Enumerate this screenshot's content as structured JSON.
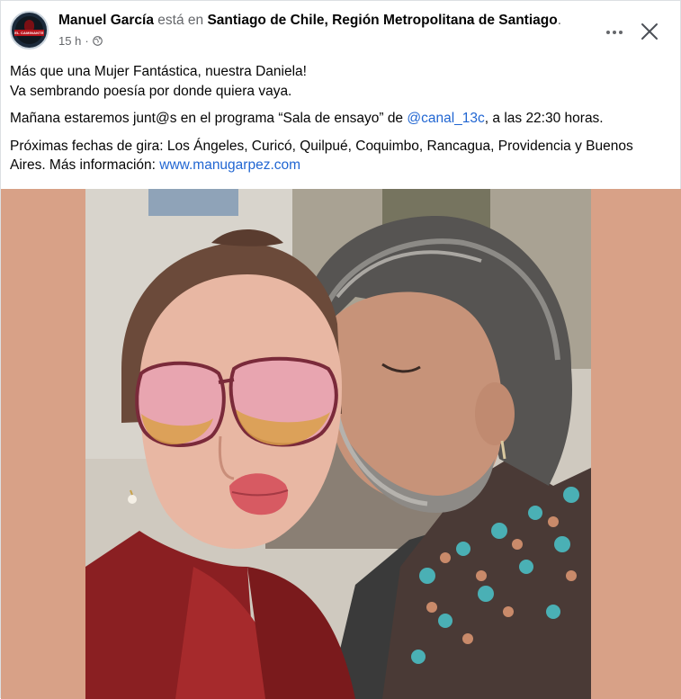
{
  "post": {
    "author": "Manuel García",
    "verb": "está en",
    "location": "Santiago de Chile, Región Metropolitana de Santiago",
    "time": "15 h",
    "separator": "·",
    "avatar_text": "EL CAMINANTE",
    "paragraphs": {
      "p1_line1": "Más que una Mujer Fantástica, nuestra Daniela!",
      "p1_line2": "Va sembrando poesía por donde quiera vaya.",
      "p2_before": "Mañana estaremos junt@s en el programa “Sala de ensayo” de ",
      "p2_link": "@canal_13c",
      "p2_after": ", a las 22:30 horas.",
      "p3_text": "Próximas fechas de gira: Los Ángeles, Curicó, Quilpué, Coquimbo, Rancagua, Providencia y Buenos Aires. Más información: ",
      "p3_link": "www.manugarpez.com"
    }
  },
  "icons": {
    "more": "more-horizontal-icon",
    "close": "close-icon",
    "privacy": "globe-icon"
  },
  "colors": {
    "link": "#2166d2",
    "secondary_text": "#65676b",
    "photo_backdrop": "#d8a187"
  }
}
